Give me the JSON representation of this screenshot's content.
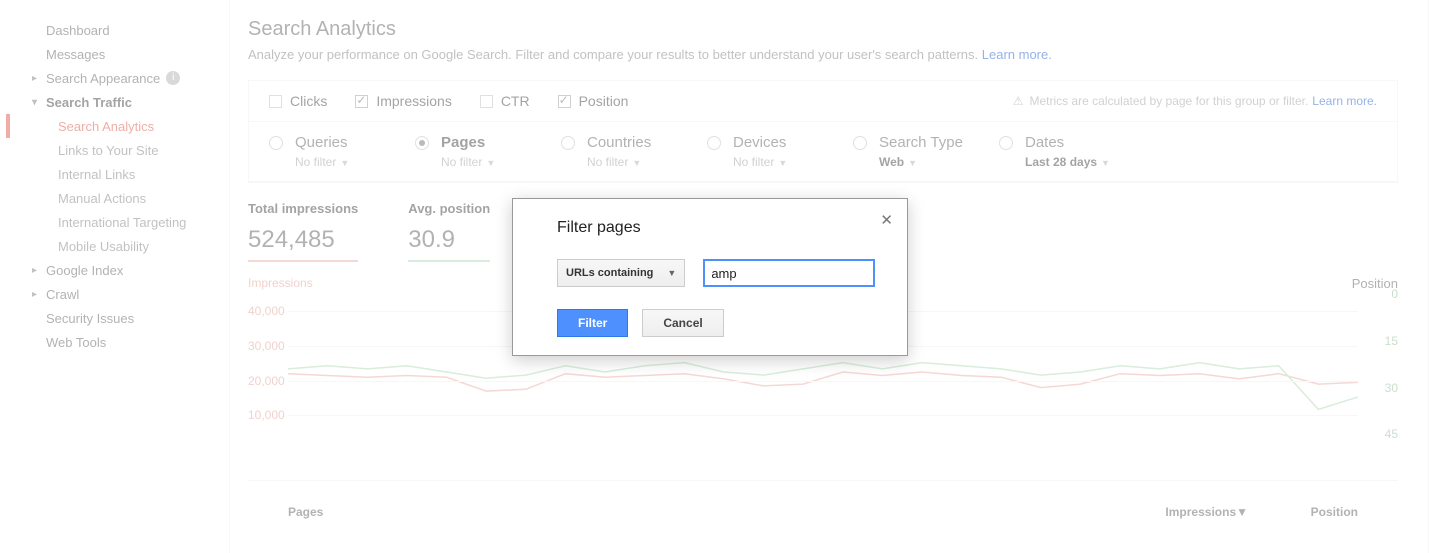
{
  "sidebar": {
    "dashboard": "Dashboard",
    "messages": "Messages",
    "search_appearance": "Search Appearance",
    "search_traffic": "Search Traffic",
    "traffic_children": [
      "Search Analytics",
      "Links to Your Site",
      "Internal Links",
      "Manual Actions",
      "International Targeting",
      "Mobile Usability"
    ],
    "google_index": "Google Index",
    "crawl": "Crawl",
    "security_issues": "Security Issues",
    "web_tools": "Web Tools"
  },
  "header": {
    "title": "Search Analytics",
    "desc": "Analyze your performance on Google Search. Filter and compare your results to better understand your user's search patterns. ",
    "learn_more": "Learn more."
  },
  "metrics": {
    "clicks": "Clicks",
    "impressions": "Impressions",
    "ctr": "CTR",
    "position": "Position",
    "warning": "Metrics are calculated by page for this group or filter.",
    "learn_more": "Learn more."
  },
  "dims": {
    "queries": "Queries",
    "queries_sub": "No filter",
    "pages": "Pages",
    "pages_sub": "No filter",
    "countries": "Countries",
    "countries_sub": "No filter",
    "devices": "Devices",
    "devices_sub": "No filter",
    "search_type": "Search Type",
    "search_type_sub": "Web",
    "dates": "Dates",
    "dates_sub": "Last 28 days"
  },
  "stats": {
    "impr_label": "Total impressions",
    "impr_value": "524,485",
    "pos_label": "Avg. position",
    "pos_value": "30.9"
  },
  "chart_data": {
    "type": "line",
    "left_axis_title": "Impressions",
    "right_axis_title": "Position",
    "left_ticks": [
      40000,
      30000,
      20000,
      10000
    ],
    "right_ticks": [
      0,
      15,
      30,
      45
    ],
    "series": [
      {
        "name": "Impressions",
        "color": "#e6a8a0",
        "values": [
          22000,
          21500,
          21000,
          21500,
          21000,
          17000,
          17500,
          22000,
          21000,
          21500,
          22000,
          20500,
          18500,
          19000,
          22500,
          21500,
          22500,
          21500,
          21000,
          18000,
          19000,
          22000,
          21500,
          22000,
          20500,
          22000,
          19000,
          19500
        ]
      },
      {
        "name": "Position",
        "color": "#a8d8b0",
        "values": [
          24,
          23,
          24,
          23,
          25,
          27,
          26,
          23,
          25,
          23,
          22,
          25,
          26,
          24,
          22,
          24,
          22,
          23,
          24,
          26,
          25,
          23,
          24,
          22,
          24,
          23,
          37,
          33
        ]
      }
    ],
    "left_range": [
      0,
      45000
    ],
    "right_range": [
      0,
      50
    ],
    "n": 28
  },
  "table": {
    "col1": "Pages",
    "col2": "Impressions▼",
    "col3": "Position"
  },
  "modal": {
    "title": "Filter pages",
    "dropdown": "URLs containing",
    "input_value": "amp",
    "filter": "Filter",
    "cancel": "Cancel"
  }
}
